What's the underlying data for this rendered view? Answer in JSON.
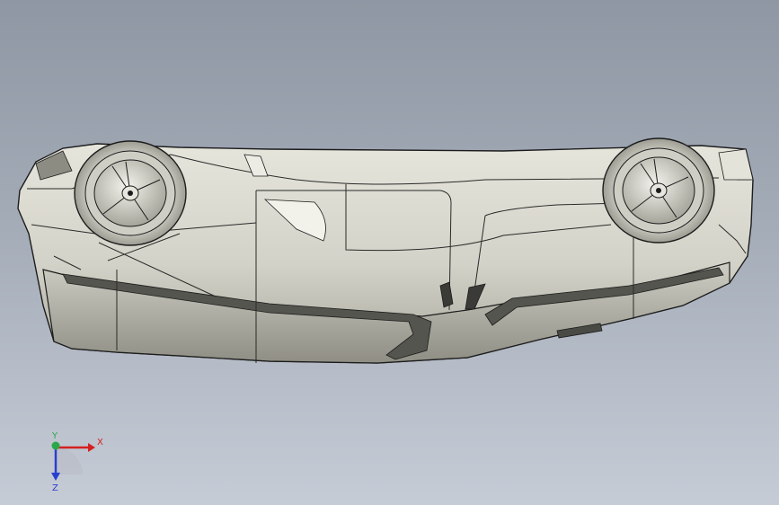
{
  "viewport": {
    "background_top": "#8f97a4",
    "background_bottom": "#c6ccd6",
    "model_fill": "#d9d8cf",
    "model_shade": "#a9a89e",
    "model_edge": "#1c1c1c"
  },
  "triad": {
    "x_label": "X",
    "y_label": "Y",
    "z_label": "Z",
    "x_color": "#d42020",
    "y_color": "#2aa84a",
    "z_color": "#2a3fd0"
  }
}
